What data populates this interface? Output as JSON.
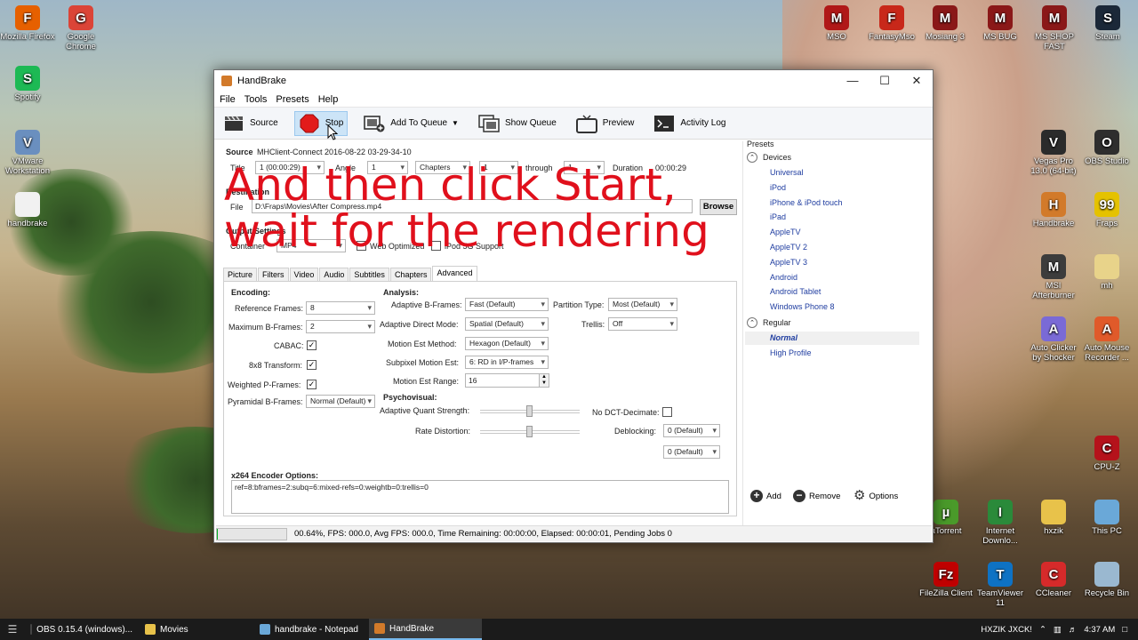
{
  "desktop": {
    "left_icons": [
      {
        "label": "Mozilla Firefox",
        "color": "#e66000",
        "glyph": "F"
      },
      {
        "label": "Google Chrome",
        "color": "#db4437",
        "glyph": "G"
      },
      {
        "label": "Spotify",
        "color": "#1db954",
        "glyph": "S"
      },
      {
        "label": "VMware Workstation",
        "color": "#6a8fbf",
        "glyph": "V"
      },
      {
        "label": "handbrake",
        "color": "#f1f1f1",
        "glyph": ""
      }
    ],
    "top_icons": [
      {
        "label": "MSO",
        "color": "#b01818",
        "glyph": "M"
      },
      {
        "label": "FantasyMso",
        "color": "#c8281a",
        "glyph": "F"
      },
      {
        "label": "Mosiang 3",
        "color": "#8a1818",
        "glyph": "M"
      },
      {
        "label": "MS BUG",
        "color": "#8a1818",
        "glyph": "M"
      },
      {
        "label": "MS SHOP FAST",
        "color": "#8a1818",
        "glyph": "M"
      },
      {
        "label": "Steam",
        "color": "#1b2838",
        "glyph": "S"
      }
    ],
    "right_icons": [
      {
        "label": "Vegas Pro 13.0 (64-bit)",
        "color": "#2b2b2b",
        "glyph": "V"
      },
      {
        "label": "OBS Studio",
        "color": "#2e2e2e",
        "glyph": "O"
      },
      {
        "label": "Handbrake",
        "color": "#d27a2a",
        "glyph": "H"
      },
      {
        "label": "Fraps",
        "color": "#e5c200",
        "glyph": "99"
      },
      {
        "label": "MSI Afterburner",
        "color": "#3c3c3c",
        "glyph": "M"
      },
      {
        "label": "mh",
        "color": "#e8d38a",
        "glyph": ""
      },
      {
        "label": "Auto Clicker by Shocker",
        "color": "#7a6ad6",
        "glyph": "A"
      },
      {
        "label": "Auto Mouse Recorder ...",
        "color": "#e05a2a",
        "glyph": "A"
      },
      {
        "label": "CPU-Z",
        "color": "#b5121b",
        "glyph": "C"
      },
      {
        "label": "µTorrent",
        "color": "#4a9a2a",
        "glyph": "µ"
      },
      {
        "label": "Internet Downlo...",
        "color": "#2a8a3a",
        "glyph": "I"
      },
      {
        "label": "hxzik",
        "color": "#e8c24a",
        "glyph": ""
      },
      {
        "label": "This PC",
        "color": "#6aa8d8",
        "glyph": ""
      },
      {
        "label": "FileZilla Client",
        "color": "#bf0000",
        "glyph": "Fz"
      },
      {
        "label": "TeamViewer 11",
        "color": "#0e72c4",
        "glyph": "T"
      },
      {
        "label": "CCleaner",
        "color": "#d62a2a",
        "glyph": "C"
      },
      {
        "label": "Recycle Bin",
        "color": "#9ab8d0",
        "glyph": ""
      }
    ]
  },
  "window": {
    "title": "HandBrake",
    "menu": [
      "File",
      "Tools",
      "Presets",
      "Help"
    ],
    "toolbar": {
      "source": "Source",
      "stop": "Stop",
      "add_to_queue": "Add To Queue",
      "show_queue": "Show Queue",
      "preview": "Preview",
      "activity_log": "Activity Log"
    },
    "source": {
      "label": "Source",
      "value": "MHClient-Connect 2016-08-22 03-29-34-10",
      "title_label": "Title",
      "title_value": "1 (00:00:29)",
      "angle_label": "Angle",
      "angle_value": "1",
      "chapters_value": "Chapters",
      "from_value": "1",
      "through_label": "through",
      "through_value": "1",
      "duration_label": "Duration",
      "duration_value": "00:00:29"
    },
    "destination": {
      "label": "Destination",
      "file_label": "File",
      "file_value": "D:\\Fraps\\Movies\\After Compress.mp4",
      "browse": "Browse"
    },
    "output": {
      "label": "Output Settings",
      "container_label": "Container",
      "container_value": "MP4",
      "web_optimized": "Web Optimized",
      "ipod_support": "iPod 5G Support"
    },
    "tabs": [
      "Picture",
      "Filters",
      "Video",
      "Audio",
      "Subtitles",
      "Chapters",
      "Advanced"
    ],
    "active_tab": "Advanced",
    "encoding": {
      "heading": "Encoding:",
      "reference_frames_label": "Reference Frames:",
      "reference_frames": "8",
      "maximum_bframes_label": "Maximum B-Frames:",
      "maximum_bframes": "2",
      "cabac_label": "CABAC:",
      "transform_label": "8x8 Transform:",
      "weighted_pframes_label": "Weighted P-Frames:",
      "pyramidal_label": "Pyramidal B-Frames:",
      "pyramidal_value": "Normal (Default)"
    },
    "analysis": {
      "heading": "Analysis:",
      "adaptive_bframes_label": "Adaptive B-Frames:",
      "adaptive_bframes": "Fast (Default)",
      "adaptive_direct_label": "Adaptive Direct Mode:",
      "adaptive_direct": "Spatial (Default)",
      "motion_method_label": "Motion Est Method:",
      "motion_method": "Hexagon (Default)",
      "subpixel_label": "Subpixel Motion Est:",
      "subpixel": "6: RD in I/P-frames",
      "motion_range_label": "Motion Est Range:",
      "motion_range": "16",
      "partition_label": "Partition Type:",
      "partition": "Most (Default)",
      "trellis_label": "Trellis:",
      "trellis": "Off"
    },
    "psychovisual": {
      "heading": "Psychovisual:",
      "aq_label": "Adaptive Quant Strength:",
      "rd_label": "Rate Distortion:",
      "no_dct_label": "No DCT-Decimate:",
      "deblocking_label": "Deblocking:",
      "deblock1": "0 (Default)",
      "deblock2": "0 (Default)"
    },
    "x264": {
      "label": "x264 Encoder Options:",
      "value": "ref=8:bframes=2:subq=6:mixed-refs=0:weightb=0:trellis=0"
    },
    "presets": {
      "heading": "Presets",
      "devices_label": "Devices",
      "devices": [
        "Universal",
        "iPod",
        "iPhone & iPod touch",
        "iPad",
        "AppleTV",
        "AppleTV 2",
        "AppleTV 3",
        "Android",
        "Android Tablet",
        "Windows Phone 8"
      ],
      "regular_label": "Regular",
      "regular": [
        "Normal",
        "High Profile"
      ],
      "add": "Add",
      "remove": "Remove",
      "options": "Options"
    },
    "status": {
      "progress_percent": 0.64,
      "text": "00.64%,  FPS: 000.0,  Avg FPS: 000.0,  Time Remaining: 00:00:00,  Elapsed: 00:00:01,  Pending Jobs 0"
    }
  },
  "overlay_text": {
    "line1": "And then click Start,",
    "line2": "wait for the rendering"
  },
  "taskbar": {
    "tasks": [
      {
        "label": "OBS 0.15.4 (windows)...",
        "color": "#444444"
      },
      {
        "label": "Movies",
        "color": "#e8c24a"
      },
      {
        "label": "handbrake - Notepad",
        "color": "#6aa8d8"
      },
      {
        "label": "HandBrake",
        "color": "#d27a2a"
      }
    ],
    "tray_text": "HXZIK JXCK!",
    "clock": "4:37 AM"
  }
}
